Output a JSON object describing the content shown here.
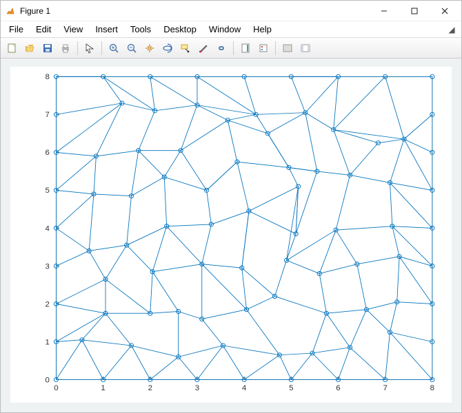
{
  "window": {
    "title": "Figure 1",
    "minimize_tip": "Minimize",
    "restore_tip": "Restore",
    "close_tip": "Close"
  },
  "menu": {
    "items": [
      "File",
      "Edit",
      "View",
      "Insert",
      "Tools",
      "Desktop",
      "Window",
      "Help"
    ]
  },
  "toolbar": {
    "groups": [
      [
        "new-figure",
        "open",
        "save",
        "print"
      ],
      [
        "edit-plot"
      ],
      [
        "zoom-in",
        "zoom-out",
        "pan",
        "rotate-3d",
        "data-cursor",
        "brush",
        "insert-colorbar"
      ],
      [
        "link-plots",
        "insert-colorbar-split"
      ],
      [
        "insert-legend",
        "hide-plot-tools"
      ],
      [
        "expand-axes",
        "dock"
      ]
    ]
  },
  "chart_data": {
    "type": "scatter",
    "title": "",
    "xlabel": "",
    "ylabel": "",
    "xlim": [
      0,
      8
    ],
    "ylim": [
      0,
      8
    ],
    "xticks": [
      0,
      1,
      2,
      3,
      4,
      5,
      6,
      7,
      8
    ],
    "yticks": [
      0,
      1,
      2,
      3,
      4,
      5,
      6,
      7,
      8
    ],
    "marker": "circle",
    "marker_edge_color": "#0072BD",
    "line_color": "#0072BD",
    "nodes": [
      [
        0,
        0
      ],
      [
        1,
        0
      ],
      [
        2,
        0
      ],
      [
        3,
        0
      ],
      [
        4,
        0
      ],
      [
        5,
        0
      ],
      [
        6,
        0
      ],
      [
        7,
        0
      ],
      [
        8,
        0
      ],
      [
        0,
        1
      ],
      [
        0,
        2
      ],
      [
        0,
        3
      ],
      [
        0,
        4
      ],
      [
        0,
        5
      ],
      [
        0,
        6
      ],
      [
        0,
        7
      ],
      [
        0,
        8
      ],
      [
        8,
        1
      ],
      [
        8,
        2
      ],
      [
        8,
        3
      ],
      [
        8,
        4
      ],
      [
        8,
        5
      ],
      [
        8,
        6
      ],
      [
        8,
        7
      ],
      [
        8,
        8
      ],
      [
        1,
        8
      ],
      [
        2,
        8
      ],
      [
        3,
        8
      ],
      [
        4,
        8
      ],
      [
        5,
        8
      ],
      [
        6,
        8
      ],
      [
        7,
        8
      ],
      [
        0.55,
        1.05
      ],
      [
        1.6,
        0.9
      ],
      [
        2.6,
        0.6
      ],
      [
        3.55,
        0.9
      ],
      [
        4.75,
        0.65
      ],
      [
        5.45,
        0.7
      ],
      [
        6.25,
        0.85
      ],
      [
        7.1,
        1.25
      ],
      [
        1.05,
        1.75
      ],
      [
        2.0,
        1.75
      ],
      [
        2.6,
        1.8
      ],
      [
        3.1,
        1.6
      ],
      [
        4.05,
        1.85
      ],
      [
        4.65,
        2.2
      ],
      [
        5.75,
        1.75
      ],
      [
        6.6,
        1.85
      ],
      [
        7.25,
        2.05
      ],
      [
        1.05,
        2.65
      ],
      [
        2.05,
        2.85
      ],
      [
        3.1,
        3.05
      ],
      [
        3.95,
        2.95
      ],
      [
        4.9,
        3.15
      ],
      [
        5.6,
        2.8
      ],
      [
        6.4,
        3.05
      ],
      [
        7.3,
        3.25
      ],
      [
        0.7,
        3.4
      ],
      [
        1.5,
        3.55
      ],
      [
        2.35,
        4.05
      ],
      [
        3.3,
        4.1
      ],
      [
        4.1,
        4.45
      ],
      [
        5.1,
        3.85
      ],
      [
        5.95,
        3.95
      ],
      [
        7.15,
        4.05
      ],
      [
        0.8,
        4.9
      ],
      [
        1.6,
        4.85
      ],
      [
        2.3,
        5.35
      ],
      [
        3.2,
        5.0
      ],
      [
        3.85,
        5.75
      ],
      [
        4.95,
        5.6
      ],
      [
        5.55,
        5.5
      ],
      [
        6.25,
        5.4
      ],
      [
        7.1,
        5.2
      ],
      [
        0.85,
        5.9
      ],
      [
        1.75,
        6.05
      ],
      [
        2.65,
        6.05
      ],
      [
        3.65,
        6.85
      ],
      [
        4.5,
        6.5
      ],
      [
        5.3,
        7.05
      ],
      [
        5.9,
        6.6
      ],
      [
        6.85,
        6.25
      ],
      [
        7.4,
        6.35
      ],
      [
        1.4,
        7.3
      ],
      [
        2.1,
        7.1
      ],
      [
        3.0,
        7.25
      ],
      [
        4.25,
        7.0
      ],
      [
        5.15,
        5.1
      ]
    ],
    "edges": [
      [
        0,
        1
      ],
      [
        1,
        2
      ],
      [
        2,
        3
      ],
      [
        3,
        4
      ],
      [
        4,
        5
      ],
      [
        5,
        6
      ],
      [
        6,
        7
      ],
      [
        7,
        8
      ],
      [
        0,
        9
      ],
      [
        9,
        10
      ],
      [
        10,
        11
      ],
      [
        11,
        12
      ],
      [
        12,
        13
      ],
      [
        13,
        14
      ],
      [
        14,
        15
      ],
      [
        15,
        16
      ],
      [
        8,
        17
      ],
      [
        17,
        18
      ],
      [
        18,
        19
      ],
      [
        19,
        20
      ],
      [
        20,
        21
      ],
      [
        21,
        22
      ],
      [
        22,
        23
      ],
      [
        23,
        24
      ],
      [
        16,
        25
      ],
      [
        25,
        26
      ],
      [
        26,
        27
      ],
      [
        27,
        28
      ],
      [
        28,
        29
      ],
      [
        29,
        30
      ],
      [
        30,
        31
      ],
      [
        31,
        24
      ],
      [
        0,
        32
      ],
      [
        1,
        32
      ],
      [
        1,
        33
      ],
      [
        2,
        33
      ],
      [
        2,
        34
      ],
      [
        3,
        34
      ],
      [
        3,
        35
      ],
      [
        4,
        35
      ],
      [
        4,
        36
      ],
      [
        5,
        36
      ],
      [
        5,
        37
      ],
      [
        6,
        37
      ],
      [
        6,
        38
      ],
      [
        7,
        38
      ],
      [
        7,
        39
      ],
      [
        8,
        39
      ],
      [
        17,
        39
      ],
      [
        9,
        32
      ],
      [
        32,
        33
      ],
      [
        33,
        40
      ],
      [
        33,
        34
      ],
      [
        34,
        42
      ],
      [
        34,
        35
      ],
      [
        35,
        43
      ],
      [
        35,
        36
      ],
      [
        36,
        44
      ],
      [
        37,
        46
      ],
      [
        36,
        37
      ],
      [
        37,
        38
      ],
      [
        38,
        46
      ],
      [
        38,
        47
      ],
      [
        39,
        47
      ],
      [
        39,
        48
      ],
      [
        9,
        40
      ],
      [
        10,
        40
      ],
      [
        40,
        41
      ],
      [
        41,
        42
      ],
      [
        42,
        43
      ],
      [
        43,
        44
      ],
      [
        44,
        45
      ],
      [
        45,
        46
      ],
      [
        46,
        47
      ],
      [
        47,
        48
      ],
      [
        48,
        18
      ],
      [
        32,
        40
      ],
      [
        10,
        49
      ],
      [
        40,
        49
      ],
      [
        41,
        49
      ],
      [
        41,
        50
      ],
      [
        42,
        50
      ],
      [
        50,
        51
      ],
      [
        43,
        51
      ],
      [
        44,
        51
      ],
      [
        44,
        52
      ],
      [
        45,
        52
      ],
      [
        45,
        53
      ],
      [
        53,
        54
      ],
      [
        46,
        54
      ],
      [
        47,
        55
      ],
      [
        54,
        55
      ],
      [
        48,
        56
      ],
      [
        55,
        56
      ],
      [
        56,
        19
      ],
      [
        18,
        56
      ],
      [
        11,
        57
      ],
      [
        49,
        57
      ],
      [
        49,
        58
      ],
      [
        50,
        58
      ],
      [
        57,
        58
      ],
      [
        50,
        59
      ],
      [
        58,
        59
      ],
      [
        51,
        59
      ],
      [
        51,
        60
      ],
      [
        59,
        60
      ],
      [
        52,
        61
      ],
      [
        60,
        61
      ],
      [
        53,
        62
      ],
      [
        61,
        62
      ],
      [
        62,
        87
      ],
      [
        53,
        63
      ],
      [
        54,
        63
      ],
      [
        55,
        63
      ],
      [
        63,
        64
      ],
      [
        56,
        64
      ],
      [
        64,
        20
      ],
      [
        19,
        64
      ],
      [
        12,
        57
      ],
      [
        12,
        65
      ],
      [
        57,
        65
      ],
      [
        58,
        66
      ],
      [
        65,
        66
      ],
      [
        59,
        67
      ],
      [
        66,
        67
      ],
      [
        67,
        68
      ],
      [
        60,
        68
      ],
      [
        61,
        69
      ],
      [
        68,
        69
      ],
      [
        87,
        70
      ],
      [
        69,
        70
      ],
      [
        62,
        71
      ],
      [
        70,
        71
      ],
      [
        63,
        72
      ],
      [
        71,
        72
      ],
      [
        64,
        73
      ],
      [
        72,
        73
      ],
      [
        73,
        21
      ],
      [
        20,
        73
      ],
      [
        13,
        65
      ],
      [
        13,
        74
      ],
      [
        65,
        74
      ],
      [
        66,
        75
      ],
      [
        74,
        75
      ],
      [
        67,
        75
      ],
      [
        67,
        76
      ],
      [
        75,
        76
      ],
      [
        68,
        76
      ],
      [
        69,
        77
      ],
      [
        76,
        77
      ],
      [
        70,
        78
      ],
      [
        77,
        78
      ],
      [
        78,
        79
      ],
      [
        71,
        79
      ],
      [
        72,
        80
      ],
      [
        79,
        80
      ],
      [
        80,
        81
      ],
      [
        81,
        82
      ],
      [
        73,
        82
      ],
      [
        82,
        22
      ],
      [
        21,
        82
      ],
      [
        72,
        81
      ],
      [
        14,
        74
      ],
      [
        14,
        83
      ],
      [
        74,
        83
      ],
      [
        75,
        84
      ],
      [
        83,
        84
      ],
      [
        76,
        85
      ],
      [
        84,
        85
      ],
      [
        77,
        85
      ],
      [
        77,
        86
      ],
      [
        85,
        86
      ],
      [
        78,
        86
      ],
      [
        86,
        79
      ],
      [
        80,
        30
      ],
      [
        80,
        82
      ],
      [
        15,
        83
      ],
      [
        83,
        25
      ],
      [
        84,
        25
      ],
      [
        84,
        26
      ],
      [
        85,
        26
      ],
      [
        85,
        27
      ],
      [
        86,
        27
      ],
      [
        86,
        28
      ],
      [
        79,
        29
      ],
      [
        29,
        30
      ],
      [
        80,
        31
      ],
      [
        82,
        31
      ],
      [
        82,
        23
      ],
      [
        16,
        25
      ],
      [
        30,
        79
      ],
      [
        71,
        70
      ],
      [
        87,
        62
      ],
      [
        87,
        53
      ],
      [
        87,
        61
      ],
      [
        61,
        52
      ],
      [
        52,
        51
      ],
      [
        69,
        68
      ],
      [
        78,
        70
      ]
    ]
  }
}
